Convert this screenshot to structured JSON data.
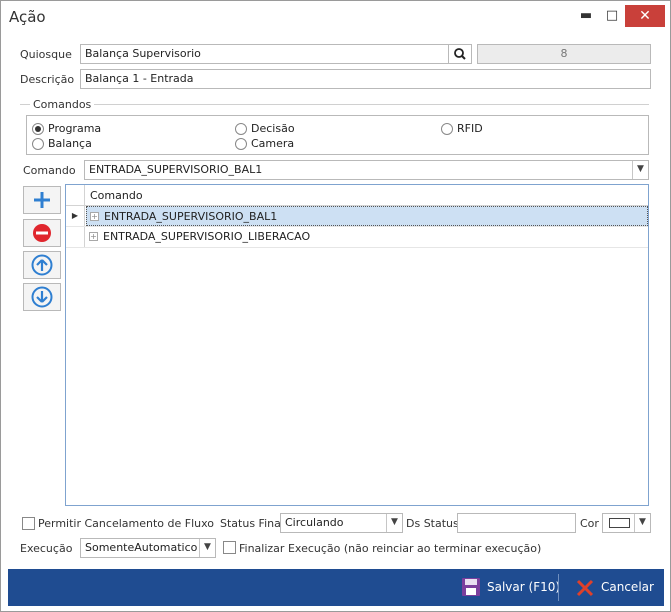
{
  "window": {
    "title": "Ação",
    "minimize": "▬",
    "maximize": "□",
    "close": "✕"
  },
  "form": {
    "quiosque_label": "Quiosque",
    "quiosque_value": "Balança Supervisorio",
    "quiosque_id": "8",
    "descricao_label": "Descrição",
    "descricao_value": "Balança 1 - Entrada"
  },
  "comandos_group": {
    "title": "Comandos",
    "options": [
      {
        "label": "Programa",
        "selected": true
      },
      {
        "label": "Balança",
        "selected": false
      },
      {
        "label": "Decisão",
        "selected": false
      },
      {
        "label": "Camera",
        "selected": false
      },
      {
        "label": "RFID",
        "selected": false
      }
    ]
  },
  "comando": {
    "label": "Comando",
    "value": "ENTRADA_SUPERVISORIO_BAL1"
  },
  "grid": {
    "column": "Comando",
    "rows": [
      {
        "value": "ENTRADA_SUPERVISORIO_BAL1",
        "selected": true
      },
      {
        "value": "ENTRADA_SUPERVISORIO_LIBERACAO",
        "selected": false
      }
    ]
  },
  "options": {
    "permitir_label": "Permitir Cancelamento de Fluxo",
    "status_final_label": "Status Final",
    "status_final_value": "Circulando",
    "ds_status_label": "Ds Status",
    "ds_status_value": "",
    "cor_label": "Cor",
    "execucao_label": "Execução",
    "execucao_value": "SomenteAutomatico",
    "finalizar_label": "Finalizar Execução (não reinciar ao terminar execução)"
  },
  "footer": {
    "save_label": "Salvar (F10)",
    "cancel_label": "Cancelar"
  },
  "colors": {
    "footer_bg": "#1f4c91",
    "add_icon": "#2f7fd1",
    "remove_icon": "#e0262d",
    "move_icon": "#2f7fd1",
    "save_icon": "#7b3f9d",
    "cancel_icon": "#e0402a",
    "selection": "#cde0f3"
  }
}
